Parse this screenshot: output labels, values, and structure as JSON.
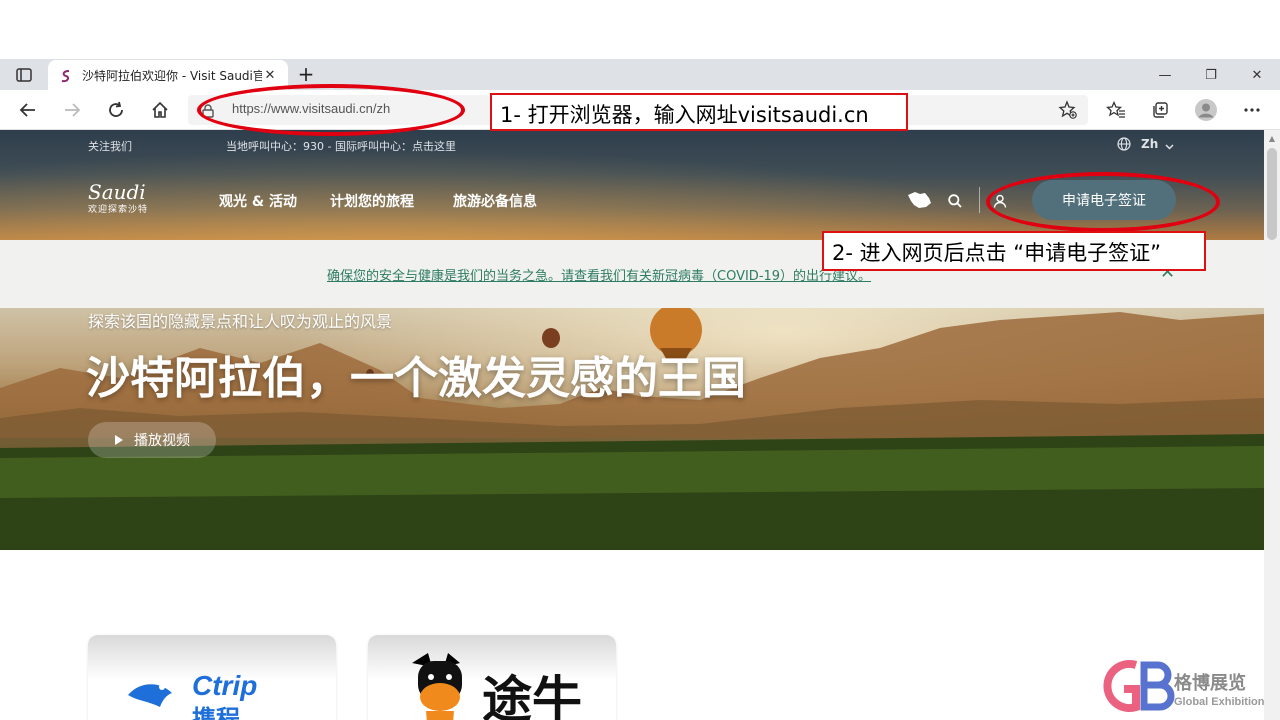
{
  "browser": {
    "tab": {
      "title": "沙特阿拉伯欢迎你 - Visit Saudi官",
      "close": "✕"
    },
    "new_tab": "+",
    "window": {
      "minimize": "—",
      "maximize": "❐",
      "close": "✕"
    },
    "address": {
      "url": "https://www.visitsaudi.cn/zh"
    }
  },
  "site": {
    "utility": {
      "follow": "关注我们",
      "hotline": "当地呼叫中心：930 - 国际呼叫中心：点击这里",
      "language": "Zh"
    },
    "logo": {
      "script": "Saudi",
      "sub": "欢迎探索沙特"
    },
    "nav": [
      "观光 & 活动",
      "计划您的旅程",
      "旅游必备信息"
    ],
    "visa_button": "申请电子签证",
    "notice": "确保您的安全与健康是我们的当务之急。请查看我们有关新冠病毒（COVID-19）的出行建议。",
    "hero": {
      "kicker": "探索该国的隐藏景点和让人叹为观止的风景",
      "headline": "沙特阿拉伯，一个激发灵感的王国",
      "play": "播放视频"
    },
    "partners": [
      {
        "name": "Ctrip",
        "sub": "携程"
      },
      {
        "name": "途牛"
      }
    ]
  },
  "annotations": {
    "step1": "1- 打开浏览器，输入网址visitsaudi.cn",
    "step2": "2- 进入网页后点击 “申请电子签证”"
  },
  "watermark": {
    "cn": "格博展览",
    "en": "Global Exhibition"
  },
  "colors": {
    "accent_red": "#e10010",
    "notice_green": "#2e7c63",
    "visa_button": "#52707c"
  }
}
